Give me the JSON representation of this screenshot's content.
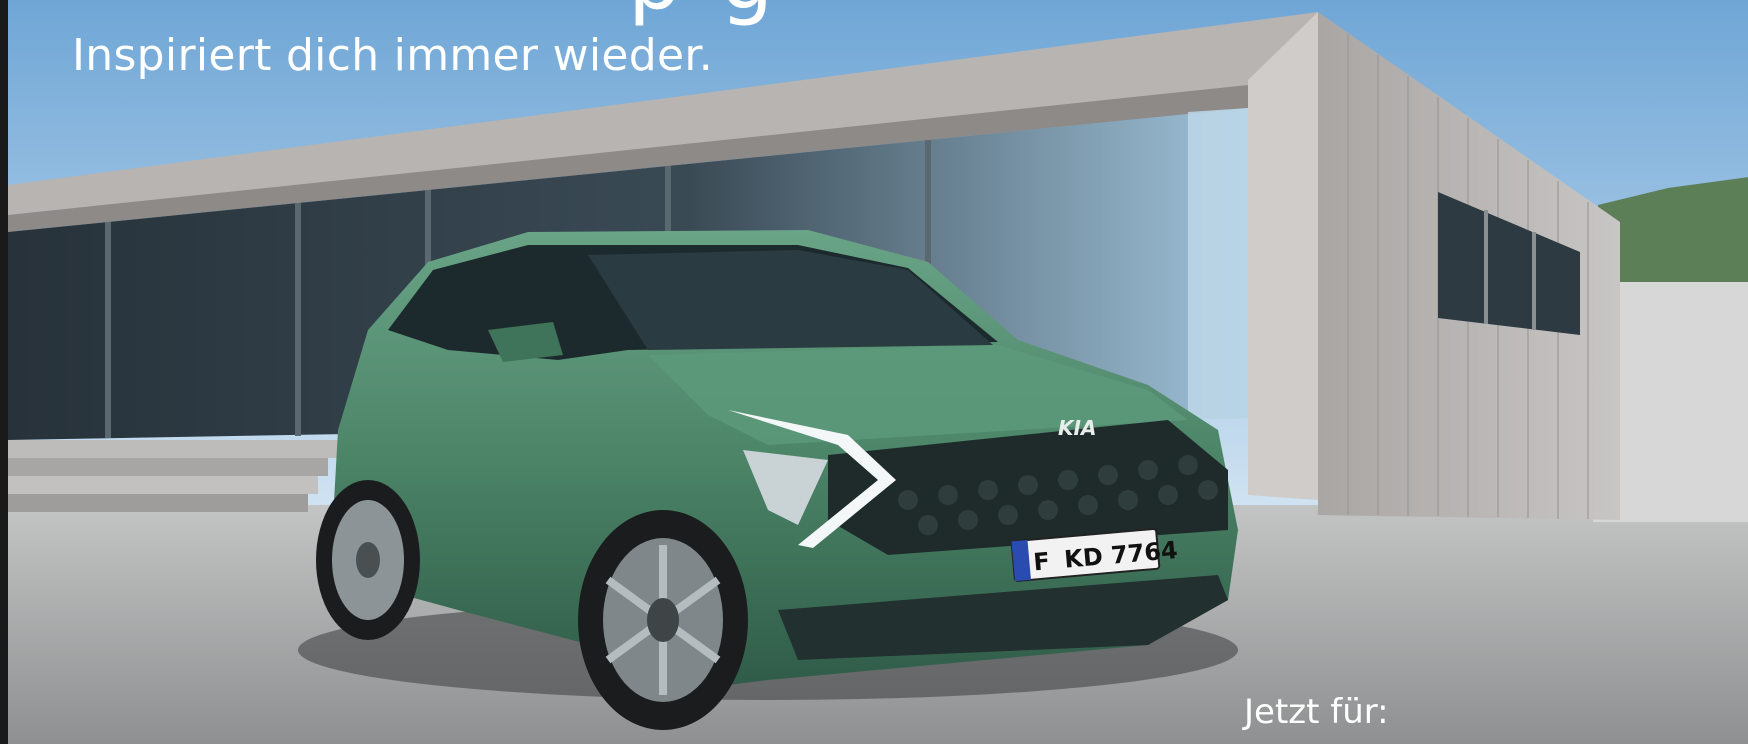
{
  "ad": {
    "headline_partial": "p   g",
    "tagline": "Inspiriert dich immer wieder.",
    "price_intro": "Jetzt für:"
  },
  "vehicle": {
    "brand_logo_text": "KIA",
    "license_plate": {
      "country_code": "F",
      "number": "KD 7764"
    }
  },
  "colors": {
    "sky_top": "#7fb1da",
    "sky_bottom": "#c9dff0",
    "concrete": "#b9b6b3",
    "car_body": "#4e8a6c",
    "ground": "#a9aaaa",
    "text": "#ffffff"
  }
}
